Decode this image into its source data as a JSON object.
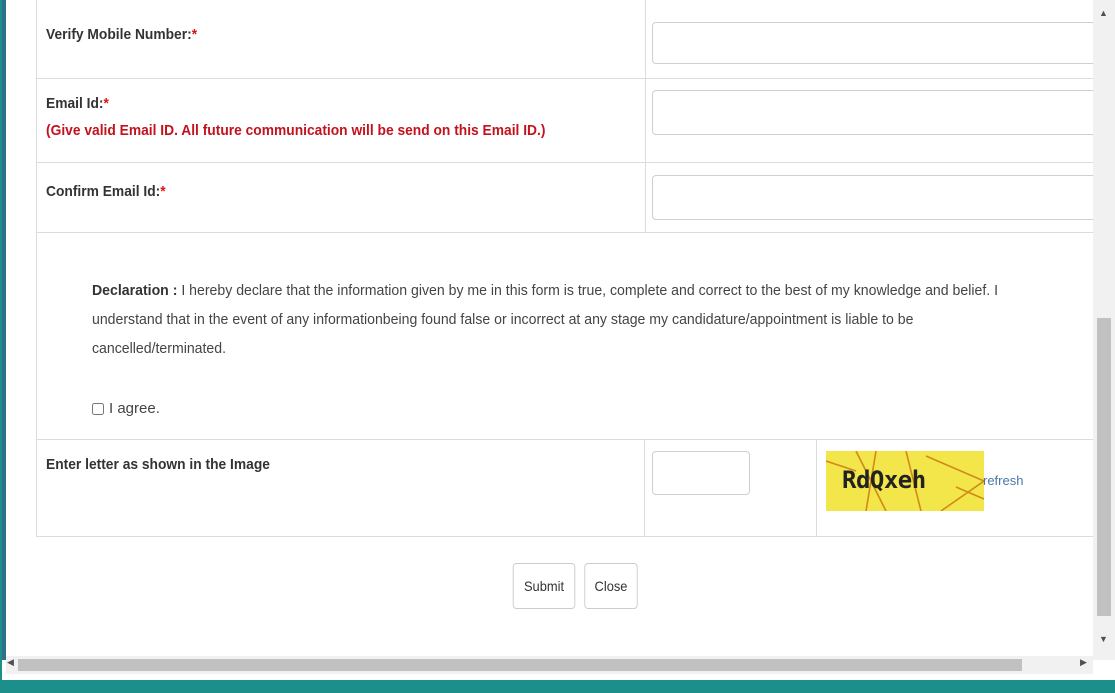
{
  "form": {
    "verify_mobile_label": "Verify Mobile Number:",
    "email_label": "Email Id:",
    "email_hint": "(Give valid Email ID. All future communication will be send on this Email ID.)",
    "confirm_email_label": "Confirm Email Id:",
    "required_mark": "*",
    "verify_mobile_value": "",
    "email_value": "",
    "confirm_email_value": ""
  },
  "declaration": {
    "heading": "Declaration :",
    "text": " I hereby declare that the information given by me in this form is true, complete and correct to the best of my knowledge and belief. I understand that in the event of any informationbeing found false or incorrect at any stage my candidature/appointment is liable to be cancelled/terminated.",
    "agree_label": "I agree."
  },
  "captcha": {
    "label": "Enter letter as shown in the Image",
    "code": "RdQxeh",
    "refresh_label": "refresh",
    "input_value": ""
  },
  "buttons": {
    "submit": "Submit",
    "close": "Close"
  },
  "colors": {
    "frame": "#1c8f8a",
    "required": "#d11111",
    "hint": "#c3121d",
    "captcha_bg": "#f2e64a",
    "link": "#4a77a8"
  }
}
